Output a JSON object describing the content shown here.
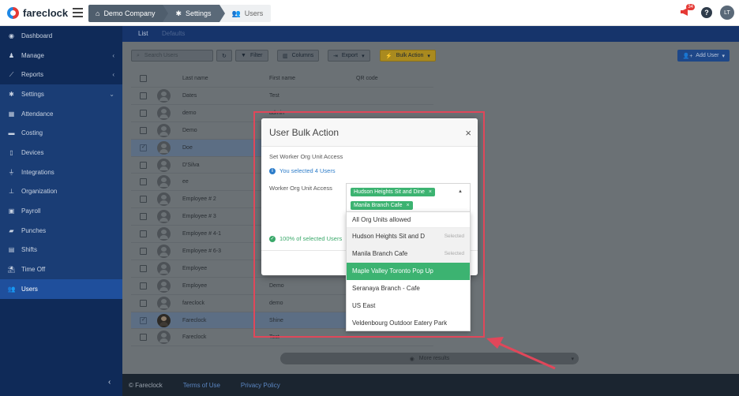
{
  "brand": {
    "name": "fareclock"
  },
  "breadcrumb": [
    {
      "label": "Demo Company",
      "icon": "home-icon"
    },
    {
      "label": "Settings",
      "icon": "gear-icon"
    },
    {
      "label": "Users",
      "icon": "users-icon"
    }
  ],
  "top": {
    "notifications_count": "34",
    "help": "?",
    "user_initials": "LT"
  },
  "sidebar": {
    "items": [
      {
        "label": "Dashboard",
        "icon": "dashboard-icon"
      },
      {
        "label": "Manage",
        "icon": "person-icon",
        "chevron": "‹"
      },
      {
        "label": "Reports",
        "icon": "chart-icon",
        "chevron": "‹"
      },
      {
        "label": "Settings",
        "icon": "gear-icon",
        "chevron": "⌄"
      },
      {
        "label": "Attendance",
        "icon": "attendance-icon"
      },
      {
        "label": "Costing",
        "icon": "costing-icon"
      },
      {
        "label": "Devices",
        "icon": "device-icon"
      },
      {
        "label": "Integrations",
        "icon": "plug-icon"
      },
      {
        "label": "Organization",
        "icon": "org-icon"
      },
      {
        "label": "Payroll",
        "icon": "money-icon"
      },
      {
        "label": "Punches",
        "icon": "punch-icon"
      },
      {
        "label": "Shifts",
        "icon": "calendar-icon"
      },
      {
        "label": "Time Off",
        "icon": "beach-icon"
      },
      {
        "label": "Users",
        "icon": "users-icon"
      }
    ],
    "collapse": "‹"
  },
  "tabs": {
    "list": "List",
    "defaults": "Defaults"
  },
  "toolbar": {
    "search_placeholder": "Search Users",
    "filter": "Filter",
    "columns": "Columns",
    "export": "Export",
    "bulk_action": "Bulk Action",
    "add_user": "Add User"
  },
  "table": {
    "headers": {
      "last": "Last name",
      "first": "First name",
      "qr": "QR code"
    },
    "rows": [
      {
        "last": "Dates",
        "first": "Test",
        "selected": false
      },
      {
        "last": "demo",
        "first": "admin",
        "selected": false
      },
      {
        "last": "Demo",
        "first": "",
        "selected": false
      },
      {
        "last": "Doe",
        "first": "",
        "selected": true
      },
      {
        "last": "D'Silva",
        "first": "",
        "selected": false
      },
      {
        "last": "ee",
        "first": "",
        "selected": false
      },
      {
        "last": "Employee # 2",
        "first": "",
        "selected": false
      },
      {
        "last": "Employee # 3",
        "first": "",
        "selected": false
      },
      {
        "last": "Employee # 4-1",
        "first": "",
        "selected": false
      },
      {
        "last": "Employee # 6-3",
        "first": "",
        "selected": false
      },
      {
        "last": "Employee",
        "first": "",
        "selected": false
      },
      {
        "last": "Employee",
        "first": "Demo",
        "selected": false
      },
      {
        "last": "fareclock",
        "first": "demo",
        "selected": false
      },
      {
        "last": "Fareclock",
        "first": "Shine",
        "selected": true,
        "photo": true
      },
      {
        "last": "Fareclock",
        "first": "Test",
        "selected": false
      }
    ]
  },
  "more_results": "More results",
  "footer": {
    "copyright": "© Fareclock",
    "terms": "Terms of Use",
    "privacy": "Privacy Policy"
  },
  "modal": {
    "title": "User Bulk Action",
    "close": "×",
    "section_label": "Set Worker Org Unit Access",
    "info": "You selected 4 Users",
    "field_label": "Worker Org Unit Access",
    "success": "100% of selected Users",
    "tags": [
      "Hudson Heights Sit and Dine",
      "Manila Branch Cafe"
    ],
    "options": [
      {
        "label": "All Org Units allowed",
        "state": ""
      },
      {
        "label": "Hudson Heights Sit and D",
        "state": "Selected"
      },
      {
        "label": "Manila Branch Cafe",
        "state": "Selected"
      },
      {
        "label": "Maple Valley Toronto Pop Up",
        "state": ""
      },
      {
        "label": "Seranaya Branch - Cafe",
        "state": ""
      },
      {
        "label": "US East",
        "state": ""
      },
      {
        "label": "Veldenbourg Outdoor Eatery Park",
        "state": ""
      }
    ]
  },
  "colors": {
    "sidebar": "#0f2a58",
    "accent_green": "#3cb371",
    "annotation": "#e0475a"
  }
}
